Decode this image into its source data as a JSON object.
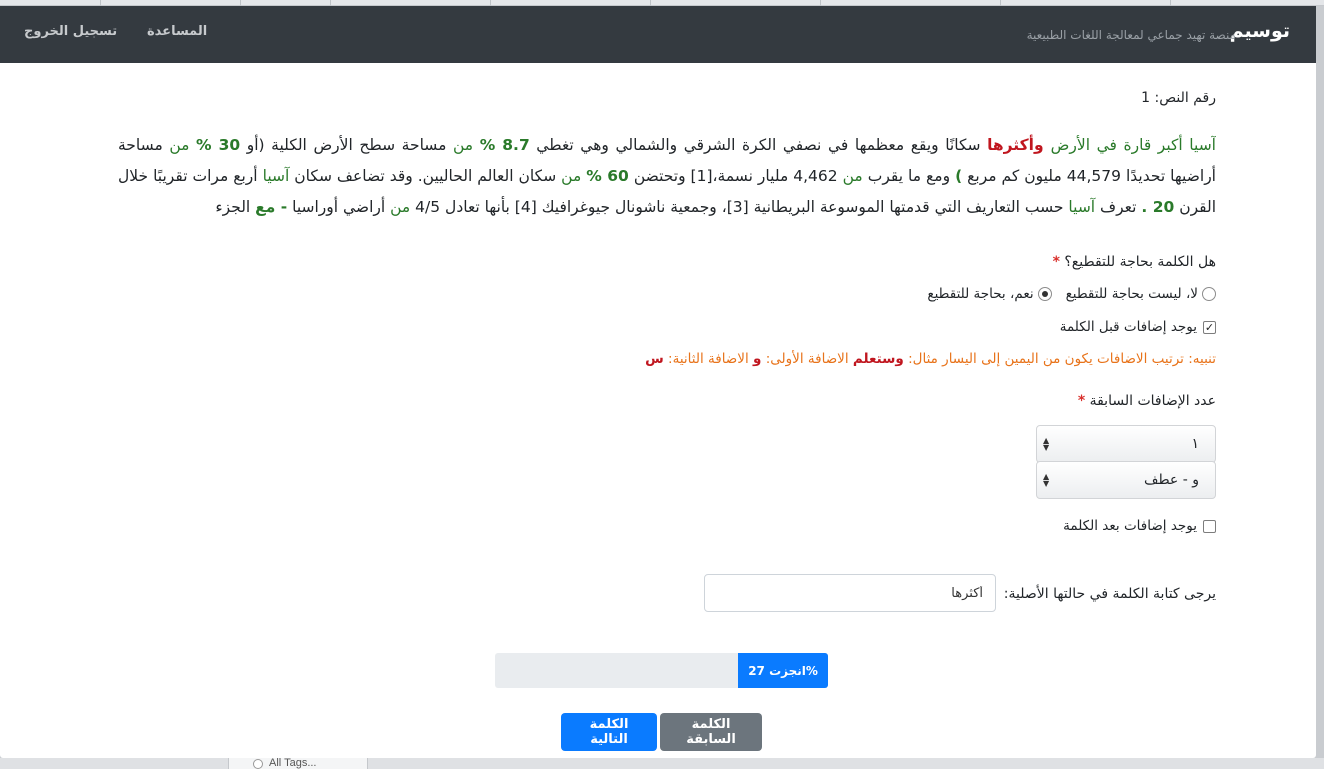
{
  "navbar": {
    "brand": "توسيم",
    "subtitle": "منصة تهيد جماعي لمعالجة اللغات الطبيعية",
    "help": "المساعدة",
    "logout": "تسجيل الخروج"
  },
  "text_number": "رقم النص: 1",
  "passage": {
    "s1": "آسيا أكبر قارة في الأرض",
    "s2": " وأكثرها",
    "s3": " سكانًا ويقع معظمها في نصفي الكرة الشرقي والشمالي وهي تغطي ",
    "s4": "8.7 %",
    "s5": " من",
    "s6": " مساحة سطح الأرض الكلية (أو ",
    "s7": "30 %",
    "s8": " من",
    "s9": " مساحة أراضيها تحديدًا 44,579 مليون كم مربع ",
    "s10": ")",
    "s11": " ومع ما يقرب ",
    "s12": "من",
    "s13": " 4,462 مليار نسمة،[1] وتحتضن ",
    "s14": "60 %",
    "s15": " من",
    "s16": " سكان العالم الحاليين. وقد تضاعف سكان ",
    "s17": "آسيا",
    "s18": " أربع مرات تقريبًا خلال القرن ",
    "s19": "20 .",
    "s20": " تعرف ",
    "s21": "آسيا",
    "s22": " حسب التعاريف التي قدمتها الموسوعة البريطانية [3]، وجمعية ناشونال جيوغرافيك [4] بأنها تعادل 4/5 ",
    "s23": "من",
    "s24": " أراضي أوراسيا ",
    "s25": "- مع",
    "s26": " الجزء"
  },
  "question": {
    "label": "هل الكلمة بحاجة للتقطيع؟",
    "required": "*",
    "option_no": "لا، ليست بحاجة للتقطيع",
    "option_yes": "نعم، بحاجة للتقطيع",
    "selected": "yes"
  },
  "prefix_check": {
    "label": "يوجد إضافات قبل الكلمة",
    "checked": true
  },
  "note": {
    "t1": "تنبيه: ترتيب الاضافات يكون من اليمين إلى اليسار مثال: ",
    "t2": "وستعلم",
    "t3": " الاضافة الأولى: ",
    "t4": "و",
    "t5": " الاضافة الثانية: ",
    "t6": "س"
  },
  "prefix_count": {
    "label": "عدد الإضافات السابقة",
    "required": "*",
    "value": "١"
  },
  "prefix_select": {
    "value": "و - عطف"
  },
  "suffix_check": {
    "label": "يوجد إضافات بعد الكلمة",
    "checked": false
  },
  "original": {
    "label": "يرجى كتابة الكلمة في حالتها الأصلية:",
    "value": "أكثرها"
  },
  "progress": {
    "label": "انجزت 27%",
    "percent": 27
  },
  "buttons": {
    "prev": "الكلمة السابقة",
    "next": "الكلمة التالية"
  },
  "background": {
    "tags": "All Tags..."
  }
}
